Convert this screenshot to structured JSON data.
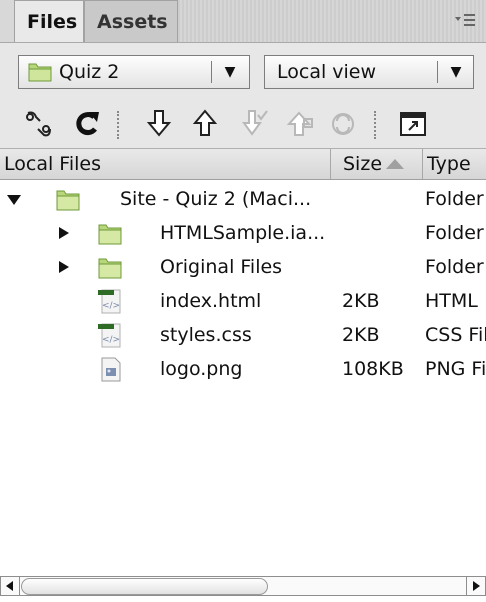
{
  "tabs": [
    {
      "label": "Files",
      "active": true
    },
    {
      "label": "Assets",
      "active": false
    }
  ],
  "panel_menu_icon": "panel-menu-icon",
  "site_select": {
    "value": "Quiz 2",
    "icon": "folder-icon"
  },
  "view_select": {
    "value": "Local view"
  },
  "toolbar": [
    {
      "name": "connect-icon",
      "enabled": true
    },
    {
      "name": "refresh-icon",
      "enabled": true
    },
    {
      "name": "get-files-icon",
      "enabled": true
    },
    {
      "name": "put-files-icon",
      "enabled": true
    },
    {
      "name": "check-out-icon",
      "enabled": false
    },
    {
      "name": "check-in-icon",
      "enabled": false
    },
    {
      "name": "synchronize-icon",
      "enabled": false
    },
    {
      "name": "expand-icon",
      "enabled": true
    }
  ],
  "columns": {
    "local_files": "Local Files",
    "size": "Size",
    "type": "Type"
  },
  "rows": [
    {
      "name": "Site - Quiz 2 (Maci...",
      "size": "",
      "type": "Folder",
      "icon": "folder-icon",
      "level": 0,
      "disclosure": "expanded"
    },
    {
      "name": "HTMLSample.ia...",
      "size": "",
      "type": "Folder",
      "icon": "folder-icon",
      "level": 1,
      "disclosure": "collapsed"
    },
    {
      "name": "Original Files",
      "size": "",
      "type": "Folder",
      "icon": "folder-icon",
      "level": 1,
      "disclosure": "collapsed"
    },
    {
      "name": "index.html",
      "size": "2KB",
      "type": "HTML",
      "icon": "html-file-icon",
      "level": 1,
      "disclosure": "none"
    },
    {
      "name": "styles.css",
      "size": "2KB",
      "type": "CSS Fil",
      "icon": "css-file-icon",
      "level": 1,
      "disclosure": "none"
    },
    {
      "name": "logo.png",
      "size": "108KB",
      "type": "PNG Fi",
      "icon": "image-file-icon",
      "level": 1,
      "disclosure": "none"
    }
  ],
  "colors": {
    "folder_green": "#b7d77a",
    "code_green": "#2e6b24",
    "header_bg": "#dcdcdc"
  }
}
